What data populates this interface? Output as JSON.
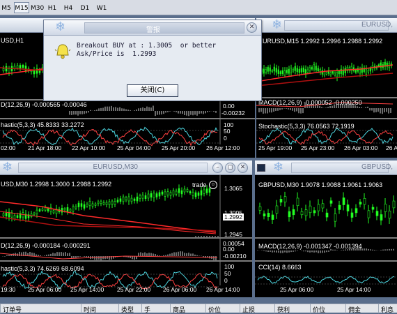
{
  "toolbar": {
    "timeframes": [
      "M5",
      "M15",
      "M30",
      "H1",
      "H4",
      "D1",
      "W1"
    ],
    "active": "M15"
  },
  "windows": {
    "top_left": {
      "title": "",
      "info": "USD,H1",
      "macd": "D(12,26,9)  -0.000565  -0.00046",
      "stoch": "hastic(5,3,3)  45.8333  33.2272",
      "axis_values": [
        "0.00",
        "-0.00232",
        "100",
        "50",
        "0"
      ],
      "dates": [
        "02:00",
        "21 Apr 18:00",
        "22 Apr 10:00",
        "25 Apr 04:00",
        "25 Apr 20:00",
        "26 Apr 12:00"
      ]
    },
    "top_right": {
      "title": "EURUSD,",
      "info": "EURUSD,M15  1.2992  1.2996  1.2988  1.2992",
      "macd": "MACD(12,26,9)  -0.000052  -0.000250",
      "stoch": "Stochastic(5,3,3)  76.0563  72.1919",
      "dates": [
        "25 Apr 19:00",
        "25 Apr 23:00",
        "26 Apr 03:00",
        "26 Apr 07:00"
      ]
    },
    "bottom_left": {
      "title": "EURUSD,M30",
      "info": "USD,M30  1.2998  1.3000  1.2988  1.2992",
      "trade_label": "trade",
      "price_levels": [
        "1.3065",
        "1.3005",
        "1.2992",
        "1.2945"
      ],
      "macd": "D(12,26,9)  -0.000184  -0.000291",
      "macd_levels": [
        "0.00054",
        "0.00",
        "-0.00210"
      ],
      "stoch": "hastic(5,3,3)  74.6269  68.6094",
      "stoch_levels": [
        "100",
        "50",
        "0"
      ],
      "dates": [
        "19:30",
        "25 Apr 06:00",
        "25 Apr 14:00",
        "25 Apr 22:00",
        "26 Apr 06:00",
        "26 Apr 14:00"
      ]
    },
    "bottom_right": {
      "title": "GBPUSD,",
      "info": "GBPUSD,M30  1.9078  1.9088  1.9061  1.9063",
      "macd": "MACD(12,26,9)  -0.001347  -0.001394",
      "cci": "CCI(14)  8.6663",
      "dates": [
        "25 Apr 06:00",
        "25 Apr 14:00"
      ]
    }
  },
  "alert": {
    "title": "警报",
    "line1": "Breakout BUY at : 1.3005  or better",
    "line2": "Ask/Price is  1.2993",
    "ok_label": "关闭(C)"
  },
  "bottom_bar": {
    "columns": [
      "订单号",
      "时间",
      "类型",
      "手",
      "商品",
      "价位",
      "止损",
      "获利",
      "价位",
      "佣金",
      "利息"
    ]
  },
  "colors": {
    "bull": "#22ff22",
    "bear": "#22ff22",
    "ma_red": "#ff2a2a",
    "ma_dark": "#b01010",
    "signal": "#f0f0f0",
    "stoch_main": "#4bd6e0",
    "stoch_signal": "#ff4040",
    "macd_hist": "#d8d8d8",
    "cci": "#4bd6e0",
    "window_title_text": "#6d7890",
    "bg": "#000000"
  }
}
